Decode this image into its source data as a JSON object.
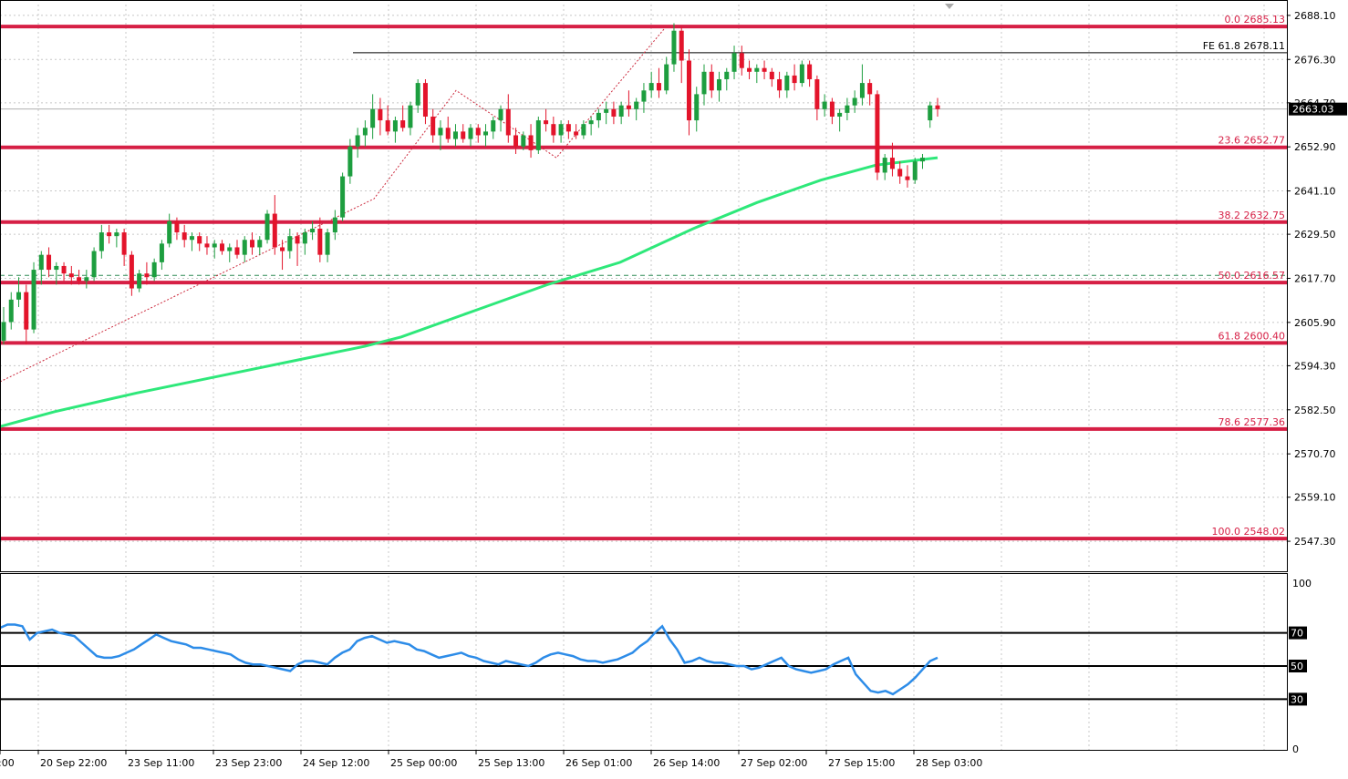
{
  "chart_data": {
    "type": "candlestick",
    "price_axis": {
      "ticks": [
        "2688.10",
        "2676.30",
        "2664.70",
        "2652.90",
        "2641.10",
        "2629.50",
        "2617.70",
        "2605.90",
        "2594.30",
        "2582.50",
        "2570.70",
        "2559.10",
        "2547.30"
      ],
      "range": [
        2540,
        2691
      ]
    },
    "current_price": "2663.03",
    "time_axis": {
      "labels": [
        "0:00",
        "20 Sep 22:00",
        "23 Sep 11:00",
        "23 Sep 23:00",
        "24 Sep 12:00",
        "25 Sep 00:00",
        "25 Sep 13:00",
        "26 Sep 01:00",
        "26 Sep 14:00",
        "27 Sep 02:00",
        "27 Sep 15:00",
        "28 Sep 03:00"
      ]
    },
    "fib_levels": [
      {
        "label": "0.0 2685.13",
        "price": 2685.13
      },
      {
        "label": "23.6 2652.77",
        "price": 2652.77
      },
      {
        "label": "38.2 2632.75",
        "price": 2632.75
      },
      {
        "label": "50.0 2616.57",
        "price": 2616.57
      },
      {
        "label": "61.8 2600.40",
        "price": 2600.4
      },
      {
        "label": "78.6 2577.36",
        "price": 2577.36
      },
      {
        "label": "100.0 2548.02",
        "price": 2548.02
      }
    ],
    "fe_level": {
      "label": "FE 61.8 2678.11",
      "price": 2678.11
    },
    "dashed_level_price": 2618.5,
    "moving_average": {
      "color": "#2ee87a",
      "points": [
        [
          0,
          2578
        ],
        [
          60,
          2582
        ],
        [
          150,
          2587
        ],
        [
          250,
          2592
        ],
        [
          330,
          2596
        ],
        [
          400,
          2599.5
        ],
        [
          440,
          2602
        ],
        [
          520,
          2609
        ],
        [
          600,
          2616
        ],
        [
          680,
          2622
        ],
        [
          760,
          2631
        ],
        [
          830,
          2638
        ],
        [
          900,
          2644
        ],
        [
          960,
          2648
        ],
        [
          1028,
          2650
        ]
      ]
    },
    "zigzag": {
      "color": "#cc2a3d",
      "points": [
        [
          0,
          2590
        ],
        [
          410,
          2639
        ],
        [
          500,
          2668
        ],
        [
          610,
          2650
        ],
        [
          730,
          2685
        ]
      ]
    },
    "candles": [
      [
        2601,
        2610,
        2600,
        2606
      ],
      [
        2606,
        2614,
        2604,
        2612
      ],
      [
        2612,
        2618,
        2610,
        2614
      ],
      [
        2614,
        2616,
        2600,
        2604
      ],
      [
        2604,
        2622,
        2603,
        2620
      ],
      [
        2620,
        2625,
        2616,
        2624
      ],
      [
        2624,
        2626,
        2618,
        2620
      ],
      [
        2620,
        2622,
        2616,
        2621
      ],
      [
        2621,
        2622,
        2617,
        2619
      ],
      [
        2619,
        2621,
        2616,
        2618
      ],
      [
        2618,
        2620,
        2616,
        2617
      ],
      [
        2617,
        2620,
        2615,
        2618
      ],
      [
        2618,
        2626,
        2617,
        2625
      ],
      [
        2625,
        2632,
        2623,
        2630
      ],
      [
        2630,
        2632,
        2627,
        2629
      ],
      [
        2629,
        2631,
        2626,
        2630
      ],
      [
        2630,
        2631,
        2621,
        2624
      ],
      [
        2624,
        2625,
        2613,
        2615
      ],
      [
        2615,
        2620,
        2614,
        2619
      ],
      [
        2619,
        2622,
        2616,
        2618
      ],
      [
        2618,
        2623,
        2617,
        2622
      ],
      [
        2622,
        2628,
        2620,
        2627
      ],
      [
        2627,
        2635,
        2626,
        2633
      ],
      [
        2633,
        2634,
        2628,
        2630
      ],
      [
        2630,
        2632,
        2626,
        2628
      ],
      [
        2628,
        2630,
        2625,
        2629
      ],
      [
        2629,
        2630,
        2625,
        2627
      ],
      [
        2627,
        2629,
        2624,
        2626
      ],
      [
        2626,
        2628,
        2623,
        2627
      ],
      [
        2627,
        2628,
        2624,
        2625
      ],
      [
        2625,
        2627,
        2622,
        2626
      ],
      [
        2626,
        2628,
        2623,
        2624
      ],
      [
        2624,
        2629,
        2622,
        2628
      ],
      [
        2628,
        2630,
        2624,
        2626
      ],
      [
        2626,
        2629,
        2624,
        2628
      ],
      [
        2628,
        2636,
        2627,
        2635
      ],
      [
        2635,
        2640,
        2624,
        2626
      ],
      [
        2626,
        2628,
        2620,
        2625
      ],
      [
        2625,
        2631,
        2623,
        2629
      ],
      [
        2629,
        2630,
        2621,
        2627
      ],
      [
        2627,
        2631,
        2624,
        2630
      ],
      [
        2630,
        2633,
        2628,
        2631
      ],
      [
        2631,
        2634,
        2622,
        2624
      ],
      [
        2624,
        2631,
        2622,
        2630
      ],
      [
        2630,
        2636,
        2628,
        2634
      ],
      [
        2634,
        2646,
        2633,
        2645
      ],
      [
        2645,
        2655,
        2643,
        2653
      ],
      [
        2653,
        2658,
        2650,
        2656
      ],
      [
        2656,
        2660,
        2653,
        2658
      ],
      [
        2658,
        2667,
        2655,
        2663
      ],
      [
        2663,
        2666,
        2656,
        2660
      ],
      [
        2660,
        2664,
        2656,
        2657
      ],
      [
        2657,
        2661,
        2654,
        2660
      ],
      [
        2660,
        2664,
        2657,
        2658
      ],
      [
        2658,
        2665,
        2656,
        2664
      ],
      [
        2664,
        2671,
        2662,
        2670
      ],
      [
        2670,
        2671,
        2659,
        2661
      ],
      [
        2661,
        2663,
        2654,
        2656
      ],
      [
        2656,
        2660,
        2652,
        2658
      ],
      [
        2658,
        2661,
        2654,
        2655
      ],
      [
        2655,
        2659,
        2653,
        2657
      ],
      [
        2657,
        2659,
        2654,
        2655
      ],
      [
        2655,
        2659,
        2653,
        2658
      ],
      [
        2658,
        2659,
        2654,
        2656
      ],
      [
        2656,
        2659,
        2653,
        2657
      ],
      [
        2657,
        2661,
        2655,
        2660
      ],
      [
        2660,
        2664,
        2657,
        2663
      ],
      [
        2663,
        2667,
        2654,
        2656
      ],
      [
        2656,
        2658,
        2651,
        2653
      ],
      [
        2653,
        2657,
        2652,
        2656
      ],
      [
        2656,
        2659,
        2650,
        2652
      ],
      [
        2652,
        2661,
        2651,
        2660
      ],
      [
        2660,
        2663,
        2657,
        2659
      ],
      [
        2659,
        2661,
        2654,
        2656
      ],
      [
        2656,
        2660,
        2654,
        2659
      ],
      [
        2659,
        2660,
        2655,
        2657
      ],
      [
        2657,
        2659,
        2655,
        2656
      ],
      [
        2656,
        2660,
        2655,
        2659
      ],
      [
        2659,
        2661,
        2656,
        2660
      ],
      [
        2660,
        2663,
        2658,
        2662
      ],
      [
        2662,
        2665,
        2659,
        2663
      ],
      [
        2663,
        2665,
        2659,
        2661
      ],
      [
        2661,
        2665,
        2659,
        2664
      ],
      [
        2664,
        2668,
        2661,
        2663
      ],
      [
        2663,
        2666,
        2660,
        2665
      ],
      [
        2665,
        2670,
        2662,
        2668
      ],
      [
        2668,
        2673,
        2666,
        2670
      ],
      [
        2670,
        2674,
        2666,
        2668
      ],
      [
        2668,
        2677,
        2667,
        2675
      ],
      [
        2675,
        2686,
        2673,
        2684
      ],
      [
        2684,
        2685,
        2670,
        2676
      ],
      [
        2676,
        2679,
        2656,
        2660
      ],
      [
        2660,
        2669,
        2657,
        2667
      ],
      [
        2667,
        2675,
        2664,
        2673
      ],
      [
        2673,
        2675,
        2666,
        2668
      ],
      [
        2668,
        2673,
        2665,
        2671
      ],
      [
        2671,
        2674,
        2668,
        2673
      ],
      [
        2673,
        2680,
        2671,
        2678
      ],
      [
        2678,
        2680,
        2672,
        2674
      ],
      [
        2674,
        2676,
        2671,
        2673
      ],
      [
        2673,
        2675,
        2670,
        2674
      ],
      [
        2674,
        2676,
        2671,
        2673
      ],
      [
        2673,
        2674,
        2669,
        2671
      ],
      [
        2671,
        2673,
        2666,
        2668
      ],
      [
        2668,
        2673,
        2666,
        2672
      ],
      [
        2672,
        2675,
        2668,
        2670
      ],
      [
        2670,
        2676,
        2669,
        2675
      ],
      [
        2675,
        2676,
        2669,
        2671
      ],
      [
        2671,
        2672,
        2660,
        2663
      ],
      [
        2663,
        2667,
        2661,
        2665
      ],
      [
        2665,
        2666,
        2659,
        2661
      ],
      [
        2661,
        2663,
        2657,
        2662
      ],
      [
        2662,
        2666,
        2660,
        2664
      ],
      [
        2664,
        2668,
        2662,
        2666
      ],
      [
        2666,
        2675,
        2664,
        2670
      ],
      [
        2670,
        2671,
        2664,
        2667
      ],
      [
        2667,
        2668,
        2644,
        2646
      ],
      [
        2646,
        2651,
        2644,
        2650
      ],
      [
        2650,
        2654,
        2645,
        2647
      ],
      [
        2647,
        2649,
        2643,
        2645
      ],
      [
        2645,
        2648,
        2642,
        2644
      ],
      [
        2644,
        2650,
        2643,
        2649
      ],
      [
        2649,
        2651,
        2647,
        2650
      ],
      [
        2660,
        2665,
        2658,
        2664
      ],
      [
        2664,
        2666,
        2661,
        2663
      ]
    ],
    "rsi": {
      "ticks": [
        "100",
        "70",
        "50",
        "30",
        "0"
      ],
      "levels": [
        "70",
        "50",
        "30"
      ],
      "color": "#2d8ce8",
      "values": [
        73,
        75,
        75,
        74,
        66,
        70,
        71,
        72,
        70,
        69,
        68,
        64,
        60,
        56,
        55,
        55,
        56,
        58,
        60,
        63,
        66,
        69,
        67,
        65,
        64,
        63,
        61,
        61,
        60,
        59,
        58,
        57,
        54,
        52,
        51,
        51,
        50,
        49,
        48,
        47,
        51,
        53,
        53,
        52,
        51,
        55,
        58,
        60,
        65,
        67,
        68,
        66,
        64,
        65,
        64,
        63,
        60,
        59,
        57,
        55,
        56,
        57,
        58,
        56,
        55,
        53,
        52,
        51,
        53,
        52,
        51,
        50,
        52,
        55,
        57,
        58,
        57,
        56,
        54,
        53,
        53,
        52,
        53,
        54,
        56,
        58,
        62,
        65,
        70,
        74,
        66,
        60,
        52,
        53,
        55,
        53,
        52,
        52,
        51,
        50,
        50,
        48,
        49,
        51,
        53,
        55,
        50,
        48,
        47,
        46,
        47,
        48,
        51,
        53,
        55,
        45,
        40,
        35,
        34,
        35,
        33,
        36,
        39,
        43,
        48,
        53,
        55
      ]
    }
  }
}
